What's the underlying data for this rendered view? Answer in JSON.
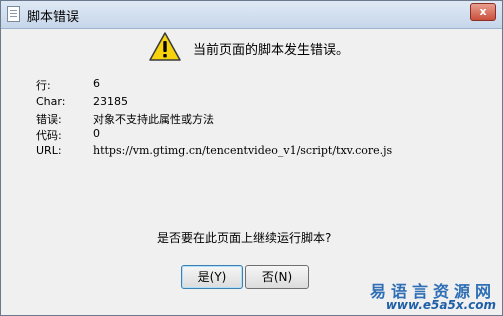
{
  "window": {
    "title": "脚本错误",
    "close_glyph": "x"
  },
  "message": "当前页面的脚本发生错误。",
  "details": [
    {
      "label": "行:",
      "value": "6"
    },
    {
      "label": "Char:",
      "value": "23185"
    },
    {
      "label": "错误:",
      "value": "对象不支持此属性或方法"
    },
    {
      "label": "代码:",
      "value": "0"
    },
    {
      "label": "URL:",
      "value": "https://vm.gtimg.cn/tencentvideo_v1/script/txv.core.js"
    }
  ],
  "question": "是否要在此页面上继续运行脚本?",
  "buttons": {
    "yes": "是(Y)",
    "no": "否(N)"
  },
  "watermark": {
    "cn": "易语言资源网",
    "url": "www.e5a5x.com"
  },
  "colors": {
    "warning_yellow": "#f6d30c",
    "title_gradient_top": "#dfe9f5",
    "close_red": "#c9503c",
    "watermark_blue": "#2f6fb5"
  }
}
